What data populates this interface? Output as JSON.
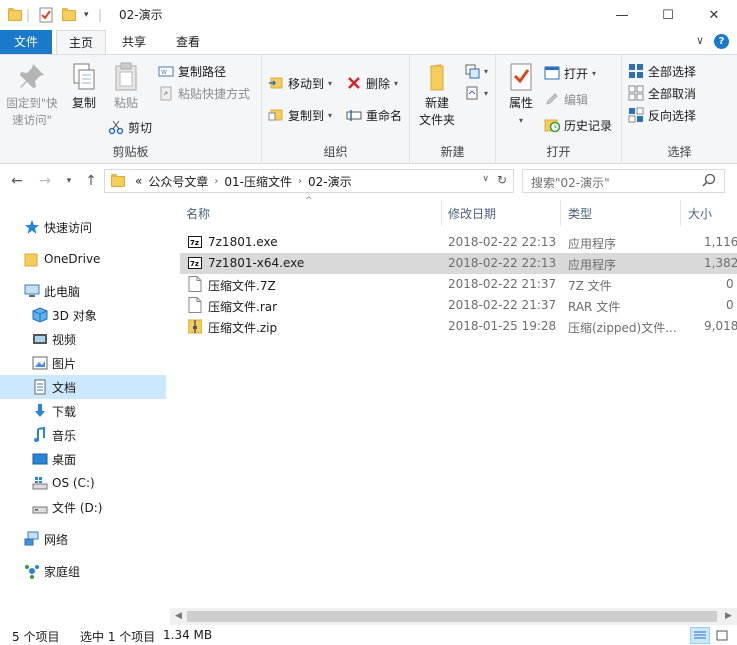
{
  "window": {
    "title": "02-演示",
    "controls": {
      "minimize": "—",
      "maximize": "☐",
      "close": "✕"
    }
  },
  "tabs": [
    {
      "label": "文件"
    },
    {
      "label": "主页"
    },
    {
      "label": "共享"
    },
    {
      "label": "查看"
    }
  ],
  "ribbon": {
    "clipboard": {
      "label": "剪贴板",
      "pin_quick_access": "固定到\"快\n速访问\"",
      "copy": "复制",
      "paste": "粘贴",
      "copy_path": "复制路径",
      "paste_shortcut": "粘贴快捷方式",
      "cut": "剪切"
    },
    "organize": {
      "label": "组织",
      "move_to": "移动到",
      "copy_to": "复制到",
      "delete": "删除",
      "rename": "重命名"
    },
    "new": {
      "label": "新建",
      "new_folder": "新建\n文件夹"
    },
    "open": {
      "label": "打开",
      "properties": "属性",
      "open": "打开",
      "edit": "编辑",
      "history": "历史记录"
    },
    "select": {
      "label": "选择",
      "select_all": "全部选择",
      "select_none": "全部取消",
      "invert": "反向选择"
    }
  },
  "address": {
    "prefix": "«",
    "crumbs": [
      "公众号文章",
      "01-压缩文件",
      "02-演示"
    ],
    "search_placeholder": "搜索\"02-演示\""
  },
  "nav": {
    "quick_access": "快速访问",
    "onedrive": "OneDrive",
    "this_pc": "此电脑",
    "objects_3d": "3D 对象",
    "videos": "视频",
    "pictures": "图片",
    "documents": "文档",
    "downloads": "下载",
    "music": "音乐",
    "desktop": "桌面",
    "drive_c": "OS (C:)",
    "drive_d": "文件 (D:)",
    "network": "网络",
    "homegroup": "家庭组"
  },
  "columns": {
    "name": "名称",
    "date": "修改日期",
    "type": "类型",
    "size": "大小"
  },
  "files": [
    {
      "name": "7z1801.exe",
      "date": "2018-02-22 22:13",
      "type": "应用程序",
      "size": "1,116",
      "icon": "7z-exe-icon"
    },
    {
      "name": "7z1801-x64.exe",
      "date": "2018-02-22 22:13",
      "type": "应用程序",
      "size": "1,382",
      "icon": "7z-exe-icon"
    },
    {
      "name": "压缩文件.7Z",
      "date": "2018-02-22 21:37",
      "type": "7Z 文件",
      "size": "0",
      "icon": "blank-file-icon"
    },
    {
      "name": "压缩文件.rar",
      "date": "2018-02-22 21:37",
      "type": "RAR 文件",
      "size": "0",
      "icon": "blank-file-icon"
    },
    {
      "name": "压缩文件.zip",
      "date": "2018-01-25 19:28",
      "type": "压缩(zipped)文件...",
      "size": "9,018",
      "icon": "zip-folder-icon"
    }
  ],
  "status": {
    "item_count": "5 个项目",
    "selected": "选中 1 个项目",
    "selected_size": "1.34 MB"
  }
}
